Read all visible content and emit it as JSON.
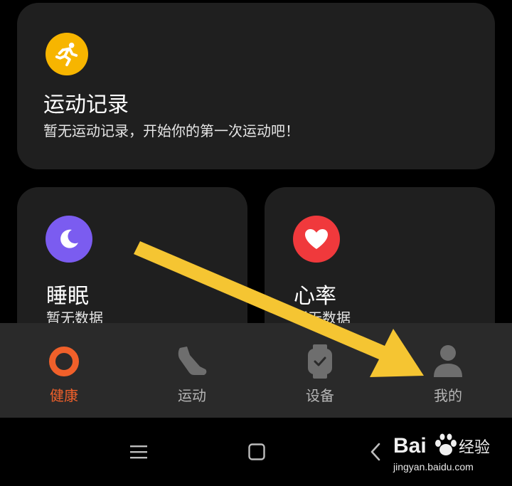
{
  "cards": {
    "exercise": {
      "title": "运动记录",
      "subtitle": "暂无运动记录，开始你的第一次运动吧！",
      "icon": "running-icon",
      "color": "#f7b500"
    },
    "sleep": {
      "title": "睡眠",
      "subtitle": "暂无数据",
      "icon": "moon-icon",
      "color": "#7b5cf0"
    },
    "heart_rate": {
      "title": "心率",
      "subtitle": "暂无数据",
      "icon": "heart-icon",
      "color": "#f0393c"
    }
  },
  "tabs": [
    {
      "label": "健康",
      "icon": "ring-icon",
      "active": true
    },
    {
      "label": "运动",
      "icon": "shoe-icon",
      "active": false
    },
    {
      "label": "设备",
      "icon": "watch-icon",
      "active": false
    },
    {
      "label": "我的",
      "icon": "person-icon",
      "active": false
    }
  ],
  "colors": {
    "accent": "#f0602a",
    "annotation_arrow": "#f5c532"
  },
  "system_nav": {
    "menu": "menu-icon",
    "home": "home-icon",
    "back": "back-icon"
  },
  "watermark": {
    "brand": "Bai",
    "brand_suffix": "经验",
    "url": "jingyan.baidu.com"
  }
}
